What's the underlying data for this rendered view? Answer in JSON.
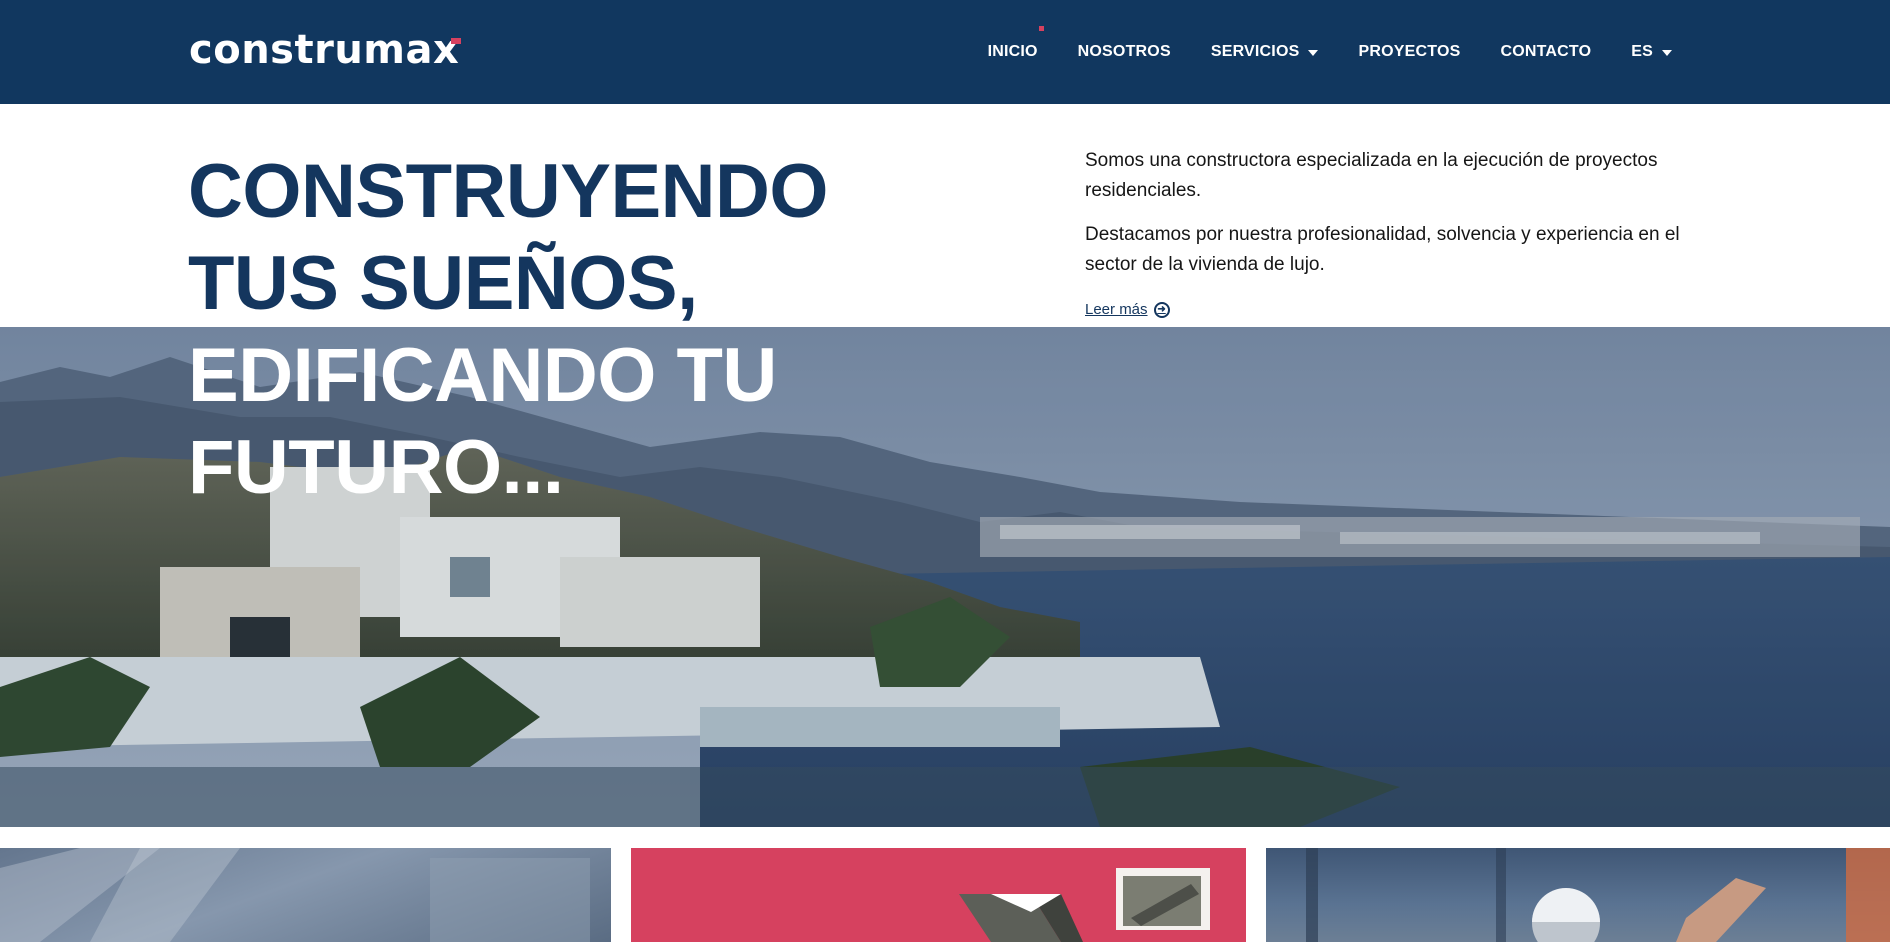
{
  "brand": {
    "logo_text": "construmax",
    "primary_color": "#11375f",
    "accent_color": "#d6415f"
  },
  "nav": {
    "items": [
      {
        "label": "INICIO",
        "active": true
      },
      {
        "label": "NOSOTROS"
      },
      {
        "label": "SERVICIOS",
        "dropdown": true
      },
      {
        "label": "PROYECTOS"
      },
      {
        "label": "CONTACTO"
      },
      {
        "label": "ES",
        "dropdown": true
      }
    ]
  },
  "hero": {
    "title_lines": [
      "CONSTRUYENDO",
      "TUS SUEÑOS,",
      "EDIFICANDO TU",
      "FUTURO..."
    ],
    "paragraphs": [
      "Somos una constructora especializada en la ejecución de proyectos residenciales.",
      "Destacamos por nuestra profesionalidad, solvencia y experiencia en el sector de la vivienda de lujo."
    ],
    "read_more_label": "Leer más",
    "read_more_icon": "arrow-circle-right-icon"
  }
}
